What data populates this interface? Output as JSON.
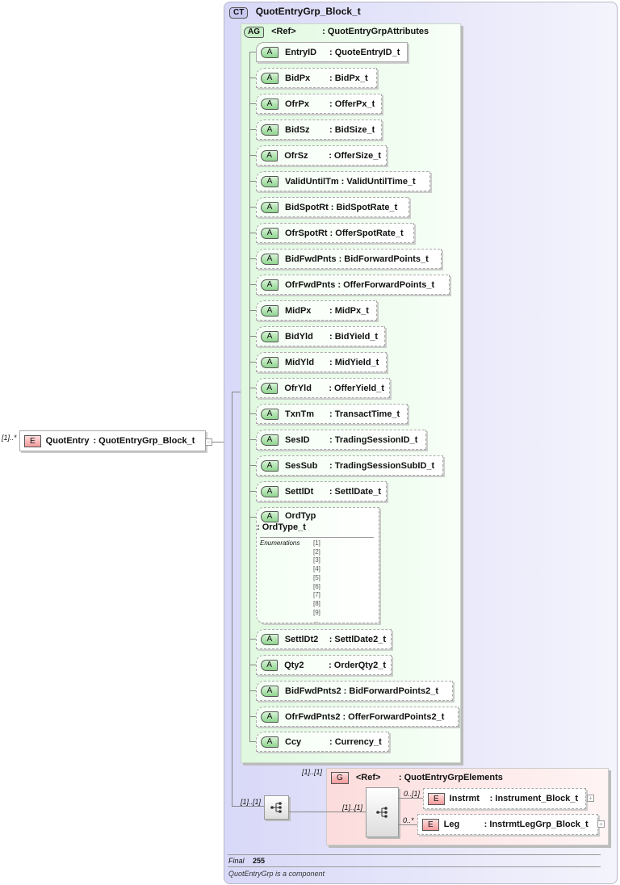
{
  "root": {
    "cardinality": "[1]..*",
    "badge": "E",
    "name": "QuotEntry",
    "type": ": QuotEntryGrp_Block_t"
  },
  "complex_type": {
    "badge": "CT",
    "name": "QuotEntryGrp_Block_t"
  },
  "attr_group": {
    "badge": "AG",
    "ref": "<Ref>",
    "name": ": QuotEntryGrpAttributes"
  },
  "attributes": [
    {
      "name": "EntryID",
      "type": ": QuoteEntryID_t"
    },
    {
      "name": "BidPx",
      "type": ": BidPx_t"
    },
    {
      "name": "OfrPx",
      "type": ": OfferPx_t"
    },
    {
      "name": "BidSz",
      "type": ": BidSize_t"
    },
    {
      "name": "OfrSz",
      "type": ": OfferSize_t"
    },
    {
      "name": "ValidUntilTm",
      "type": ": ValidUntilTime_t"
    },
    {
      "name": "BidSpotRt",
      "type": ": BidSpotRate_t"
    },
    {
      "name": "OfrSpotRt",
      "type": ": OfferSpotRate_t"
    },
    {
      "name": "BidFwdPnts",
      "type": ": BidForwardPoints_t"
    },
    {
      "name": "OfrFwdPnts",
      "type": ": OfferForwardPoints_t"
    },
    {
      "name": "MidPx",
      "type": ": MidPx_t"
    },
    {
      "name": "BidYld",
      "type": ": BidYield_t"
    },
    {
      "name": "MidYld",
      "type": ": MidYield_t"
    },
    {
      "name": "OfrYld",
      "type": ": OfferYield_t"
    },
    {
      "name": "TxnTm",
      "type": ": TransactTime_t"
    },
    {
      "name": "SesID",
      "type": ": TradingSessionID_t"
    },
    {
      "name": "SesSub",
      "type": ": TradingSessionSubID_t"
    },
    {
      "name": "SettlDt",
      "type": ": SettlDate_t"
    },
    {
      "name": "OrdTyp",
      "type": ": OrdType_t"
    },
    {
      "name": "SettlDt2",
      "type": ": SettlDate2_t"
    },
    {
      "name": "Qty2",
      "type": ": OrderQty2_t"
    },
    {
      "name": "BidFwdPnts2",
      "type": ": BidForwardPoints2_t"
    },
    {
      "name": "OfrFwdPnts2",
      "type": ": OfferForwardPoints2_t"
    },
    {
      "name": "Ccy",
      "type": ": Currency_t"
    }
  ],
  "attr_badge": "A",
  "enumerations": {
    "label": "Enumerations",
    "values": [
      "[1]",
      "[2]",
      "[3]",
      "[4]",
      "[5]",
      "[6]",
      "[7]",
      "[8]",
      "[9]",
      "..."
    ]
  },
  "sequence": {
    "cardinality": "[1]..[1]"
  },
  "group": {
    "cardinality": "[1]..[1]",
    "badge": "G",
    "ref": "<Ref>",
    "name": ": QuotEntryGrpElements",
    "seq_cardinality": "[1]..[1]",
    "elements": [
      {
        "cardinality": "0..[1]",
        "badge": "E",
        "name": "Instrmt",
        "type": ": Instrument_Block_t"
      },
      {
        "cardinality": "0..*",
        "badge": "E",
        "name": "Leg",
        "type": ": InstrmtLegGrp_Block_t"
      }
    ]
  },
  "footer": {
    "final_label": "Final",
    "final_value": "255",
    "note": "QuotEntryGrp is a component"
  }
}
